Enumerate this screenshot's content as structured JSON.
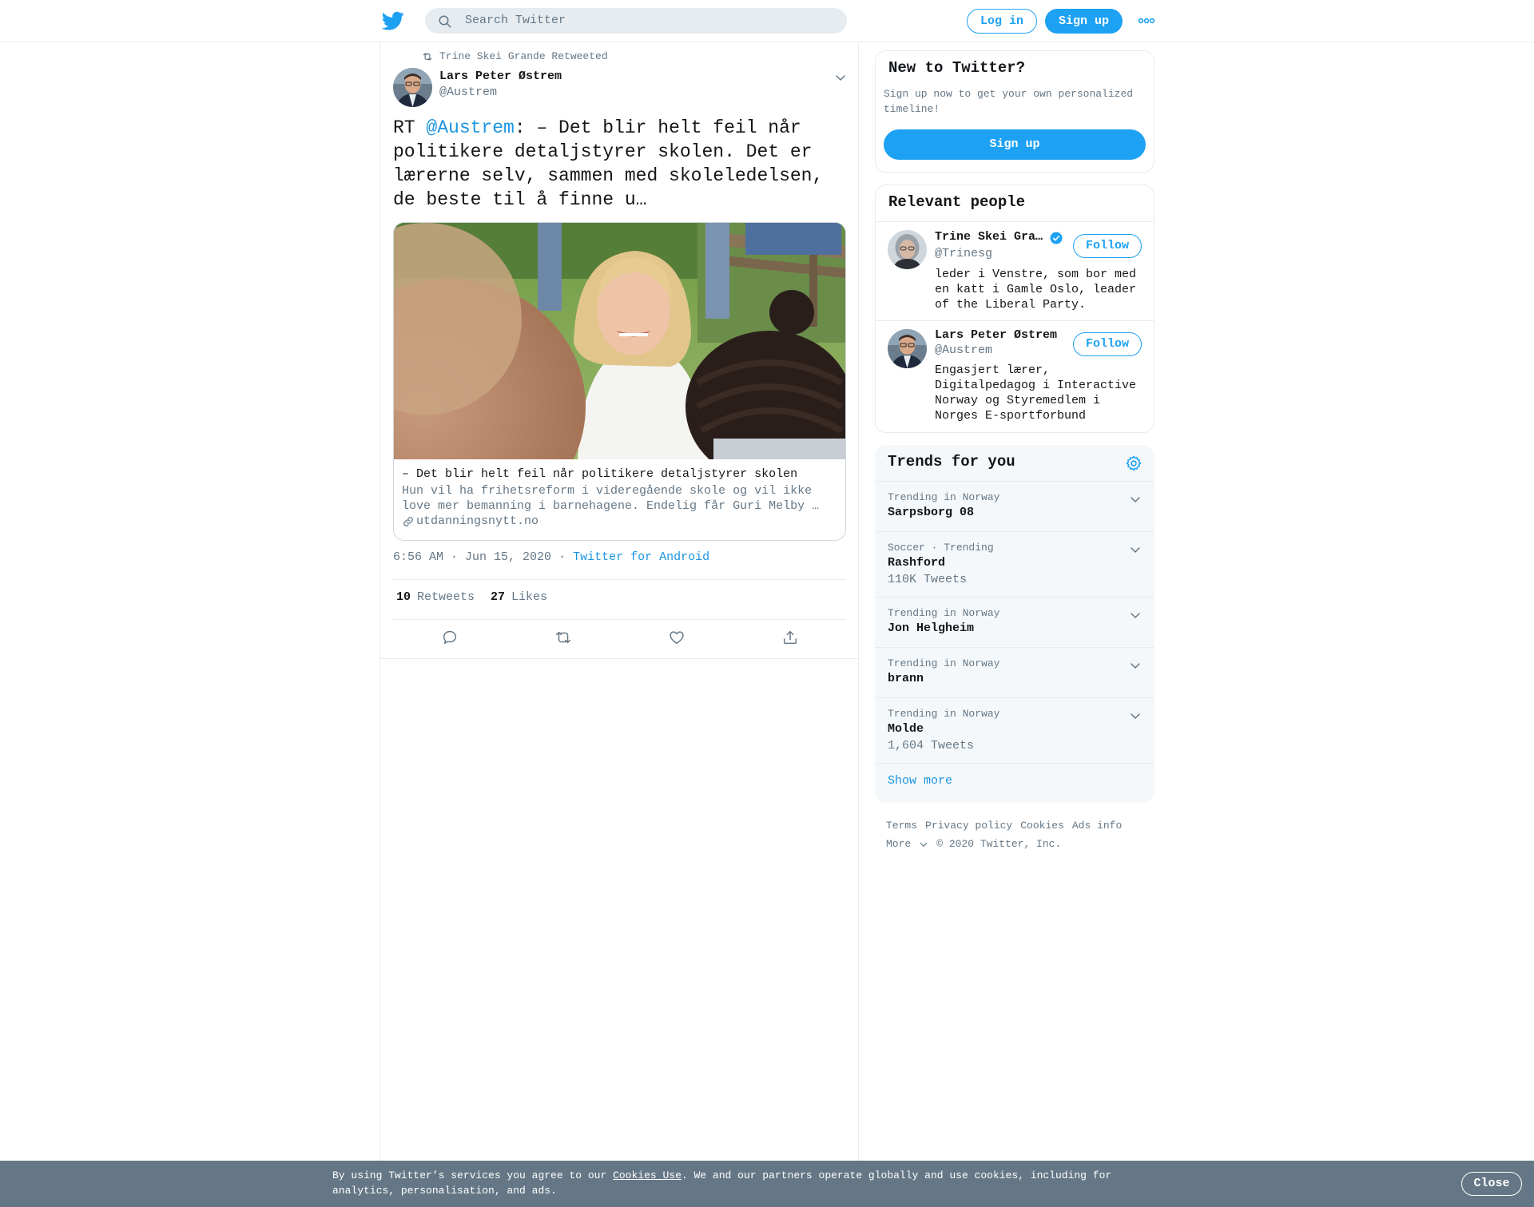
{
  "header": {
    "search_placeholder": "Search Twitter",
    "login_label": "Log in",
    "signup_label": "Sign up"
  },
  "tweet": {
    "retweeted_by": "Trine Skei Grande Retweeted",
    "author_name": "Lars Peter Østrem",
    "author_handle": "@Austrem",
    "text_prefix": "RT ",
    "text_mention": "@Austrem",
    "text_body": ": – Det blir helt feil når politikere detaljstyrer skolen. Det er lærerne selv, sammen med skoleledelsen, de beste til å finne u…",
    "card": {
      "title": "– Det blir helt feil når politikere detaljstyrer skolen",
      "description": "Hun vil ha frihetsreform i videregående skole og vil ikke love mer bemanning i barnehagene. Endelig får Guri Melby …",
      "domain": "utdanningsnytt.no"
    },
    "time": "6:56 AM · Jun 15, 2020",
    "separator": "·",
    "source": "Twitter for Android",
    "retweets_count": "10",
    "retweets_label": "Retweets",
    "likes_count": "27",
    "likes_label": "Likes"
  },
  "new_to_twitter": {
    "title": "New to Twitter?",
    "subtitle": "Sign up now to get your own personalized timeline!",
    "button": "Sign up"
  },
  "relevant_people": {
    "title": "Relevant people",
    "people": [
      {
        "name": "Trine Skei Gra…",
        "handle": "@Trinesg",
        "bio": "leder i Venstre, som bor med en katt i Gamle Oslo, leader of the Liberal Party.",
        "follow": "Follow",
        "verified": true
      },
      {
        "name": "Lars Peter Østrem",
        "handle": "@Austrem",
        "bio": "Engasjert lærer, Digitalpedagog i Interactive Norway og Styremedlem i Norges E-sportforbund",
        "follow": "Follow",
        "verified": false
      }
    ]
  },
  "trends": {
    "title": "Trends for you",
    "items": [
      {
        "context": "Trending in Norway",
        "name": "Sarpsborg 08",
        "count": ""
      },
      {
        "context": "Soccer · Trending",
        "name": "Rashford",
        "count": "110K Tweets"
      },
      {
        "context": "Trending in Norway",
        "name": "Jon Helgheim",
        "count": ""
      },
      {
        "context": "Trending in Norway",
        "name": "brann",
        "count": ""
      },
      {
        "context": "Trending in Norway",
        "name": "Molde",
        "count": "1,604 Tweets"
      }
    ],
    "show_more": "Show more"
  },
  "footer": {
    "links": [
      "Terms",
      "Privacy policy",
      "Cookies",
      "Ads info"
    ],
    "more": "More",
    "copyright": "© 2020 Twitter, Inc."
  },
  "cookie_banner": {
    "text_before": "By using Twitter’s services you agree to our ",
    "link": "Cookies Use",
    "text_after": ". We and our partners operate globally and use cookies, including for analytics, personalisation, and ads.",
    "close": "Close"
  },
  "colors": {
    "accent": "#1da1f2",
    "link": "#1b95e0",
    "secondary_text": "#657786",
    "border": "#e6ecf0",
    "banner": "#657786"
  }
}
